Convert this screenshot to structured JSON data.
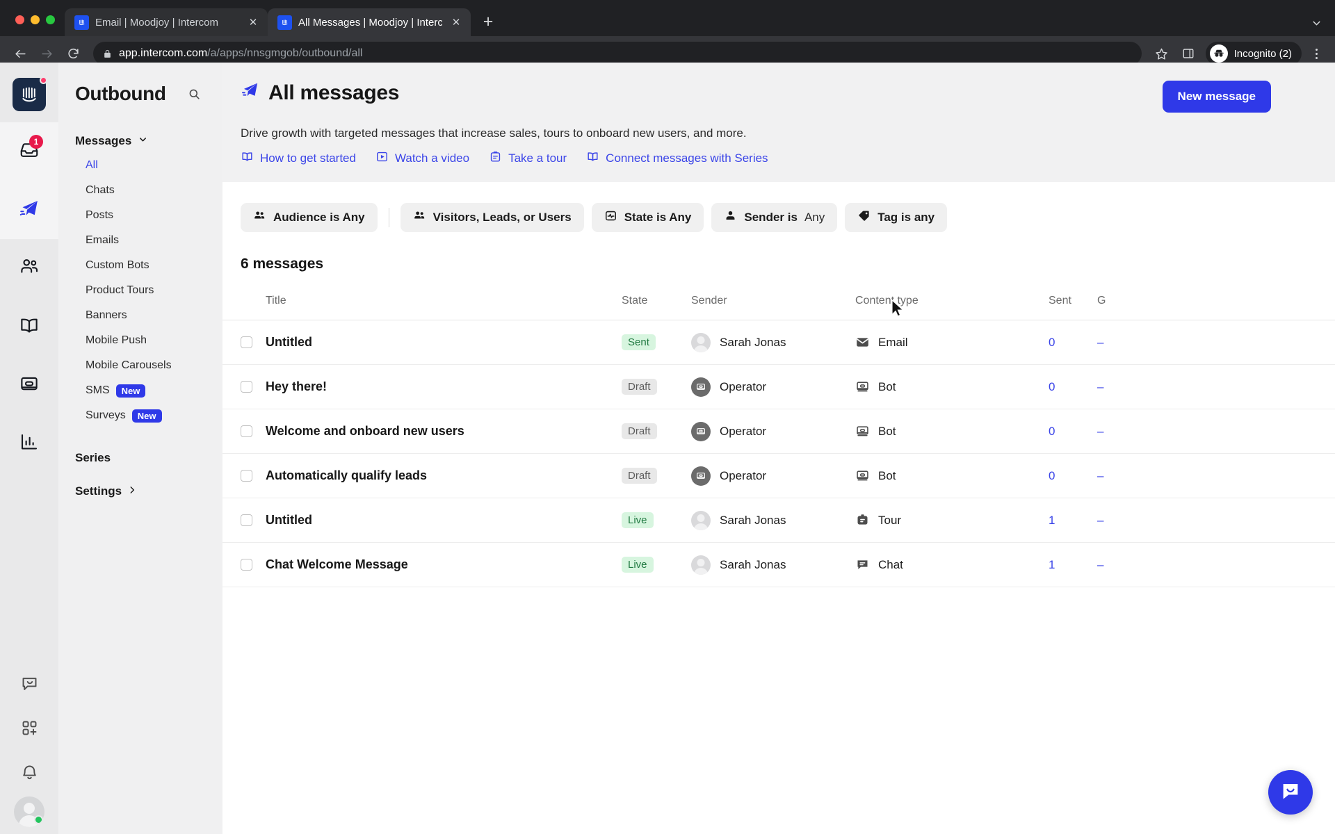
{
  "browser": {
    "tabs": [
      {
        "title": "Email | Moodjoy | Intercom",
        "active": false,
        "favicon": "intercom-icon",
        "close": "✕"
      },
      {
        "title": "All Messages | Moodjoy | Interc",
        "active": true,
        "favicon": "intercom-icon",
        "close": "✕"
      }
    ],
    "new_tab_label": "+",
    "url_main": "app.intercom.com",
    "url_path": "/a/apps/nnsgmgob/outbound/all",
    "profile_label": "Incognito (2)",
    "back_icon": "back-arrow-icon",
    "forward_icon": "forward-arrow-icon",
    "reload_icon": "reload-icon",
    "lock_icon": "lock-icon",
    "bookmark_icon": "star-icon",
    "sidepanel_icon": "side-panel-icon",
    "menu_icon": "kebab-menu-icon",
    "tabsearch_icon": "chevron-down-icon"
  },
  "rail": {
    "logo": "intercom-logo",
    "items": [
      {
        "name": "inbox",
        "icon": "inbox-icon",
        "badge": "1",
        "selected": true
      },
      {
        "name": "outbound",
        "icon": "paper-plane-icon",
        "badge": "",
        "selected": true
      },
      {
        "name": "contacts",
        "icon": "people-icon",
        "badge": "",
        "selected": false
      },
      {
        "name": "articles",
        "icon": "book-icon",
        "badge": "",
        "selected": false
      },
      {
        "name": "messenger",
        "icon": "messenger-card-icon",
        "badge": "",
        "selected": false
      },
      {
        "name": "reports",
        "icon": "bar-chart-icon",
        "badge": "",
        "selected": false
      }
    ],
    "bottom": [
      {
        "name": "help-chat",
        "icon": "chat-bubble-icon"
      },
      {
        "name": "apps",
        "icon": "apps-grid-plus-icon"
      },
      {
        "name": "notifications",
        "icon": "bell-icon"
      }
    ],
    "avatar": "user-avatar"
  },
  "sidebar": {
    "title": "Outbound",
    "search_icon": "search-icon",
    "group_label": "Messages",
    "group_chevron": "chevron-down-icon",
    "links": [
      {
        "label": "All",
        "active": true,
        "badge": ""
      },
      {
        "label": "Chats",
        "active": false,
        "badge": ""
      },
      {
        "label": "Posts",
        "active": false,
        "badge": ""
      },
      {
        "label": "Emails",
        "active": false,
        "badge": ""
      },
      {
        "label": "Custom Bots",
        "active": false,
        "badge": ""
      },
      {
        "label": "Product Tours",
        "active": false,
        "badge": ""
      },
      {
        "label": "Banners",
        "active": false,
        "badge": ""
      },
      {
        "label": "Mobile Push",
        "active": false,
        "badge": ""
      },
      {
        "label": "Mobile Carousels",
        "active": false,
        "badge": ""
      },
      {
        "label": "SMS",
        "active": false,
        "badge": "New"
      },
      {
        "label": "Surveys",
        "active": false,
        "badge": "New"
      }
    ],
    "series_label": "Series",
    "settings_label": "Settings",
    "settings_chevron": "chevron-right-icon"
  },
  "hero": {
    "icon": "paper-plane-icon",
    "title": "All messages",
    "subtitle": "Drive growth with targeted messages that increase sales, tours to onboard new users, and more.",
    "links": [
      {
        "label": "How to get started",
        "icon": "book-icon"
      },
      {
        "label": "Watch a video",
        "icon": "play-icon"
      },
      {
        "label": "Take a tour",
        "icon": "clipboard-icon"
      },
      {
        "label": "Connect messages with Series",
        "icon": "book-icon"
      }
    ],
    "new_message_label": "New message"
  },
  "filters": [
    {
      "label": "Audience is Any",
      "value": "",
      "icon": "people-icon",
      "divider_after": true
    },
    {
      "label": "Visitors, Leads, or Users",
      "value": "",
      "icon": "people-icon",
      "divider_after": false
    },
    {
      "label": "State is Any",
      "value": "",
      "icon": "state-pulse-icon",
      "divider_after": false
    },
    {
      "label": "Sender is",
      "value": "Any",
      "icon": "person-icon",
      "divider_after": false
    },
    {
      "label": "Tag is any",
      "value": "",
      "icon": "tag-icon",
      "divider_after": false
    }
  ],
  "table": {
    "count_label": "6 messages",
    "columns": [
      "Title",
      "State",
      "Sender",
      "Content type",
      "Sent",
      "G"
    ],
    "rows": [
      {
        "title": "Untitled",
        "state": "Sent",
        "state_kind": "sent",
        "sender": "Sarah Jonas",
        "sender_kind": "person",
        "content_type": "Email",
        "content_icon": "envelope-icon",
        "sent": "0",
        "goal": "–"
      },
      {
        "title": "Hey there!",
        "state": "Draft",
        "state_kind": "draft",
        "sender": "Operator",
        "sender_kind": "operator",
        "content_type": "Bot",
        "content_icon": "bot-icon",
        "sent": "0",
        "goal": "–"
      },
      {
        "title": "Welcome and onboard new users",
        "state": "Draft",
        "state_kind": "draft",
        "sender": "Operator",
        "sender_kind": "operator",
        "content_type": "Bot",
        "content_icon": "bot-icon",
        "sent": "0",
        "goal": "–"
      },
      {
        "title": "Automatically qualify leads",
        "state": "Draft",
        "state_kind": "draft",
        "sender": "Operator",
        "sender_kind": "operator",
        "content_type": "Bot",
        "content_icon": "bot-icon",
        "sent": "0",
        "goal": "–"
      },
      {
        "title": "Untitled",
        "state": "Live",
        "state_kind": "live",
        "sender": "Sarah Jonas",
        "sender_kind": "person",
        "content_type": "Tour",
        "content_icon": "tour-icon",
        "sent": "1",
        "goal": "–"
      },
      {
        "title": "Chat Welcome Message",
        "state": "Live",
        "state_kind": "live",
        "sender": "Sarah Jonas",
        "sender_kind": "person",
        "content_type": "Chat",
        "content_icon": "chat-icon",
        "sent": "1",
        "goal": "–"
      }
    ]
  },
  "launcher": {
    "icon": "messenger-launcher-icon"
  },
  "colors": {
    "accent": "#2f39e8",
    "link": "#3b45e8",
    "status_green_bg": "#d7f5df",
    "status_green_text": "#217a42",
    "status_gray_bg": "#e8e8e8",
    "badge_red": "#e8194b"
  }
}
